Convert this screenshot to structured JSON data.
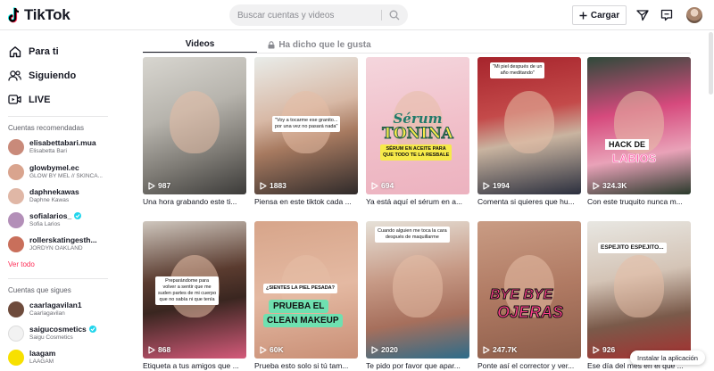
{
  "header": {
    "logo_text": "TikTok",
    "search_placeholder": "Buscar cuentas y videos",
    "upload_label": "Cargar"
  },
  "sidebar": {
    "nav": [
      {
        "label": "Para ti",
        "icon": "home-icon"
      },
      {
        "label": "Siguiendo",
        "icon": "people-icon"
      },
      {
        "label": "LIVE",
        "icon": "live-icon"
      }
    ],
    "recommended_heading": "Cuentas recomendadas",
    "recommended": [
      {
        "name": "elisabettabari.mua",
        "sub": "Elisabetta Bari",
        "verified": false,
        "color": "#c98a7a"
      },
      {
        "name": "glowbymel.ec",
        "sub": "GLOW BY MEL // SKINCA...",
        "verified": false,
        "color": "#d9a48e"
      },
      {
        "name": "daphnekawas",
        "sub": "Daphne Kawas",
        "verified": false,
        "color": "#e0b7a6"
      },
      {
        "name": "sofialarios_",
        "sub": "Sofia Larios",
        "verified": true,
        "color": "#b38fb8"
      },
      {
        "name": "rollerskatingesth...",
        "sub": "JORDYN OAKLAND",
        "verified": false,
        "color": "#c96f5b"
      }
    ],
    "see_all": "Ver todo",
    "following_heading": "Cuentas que sigues",
    "following": [
      {
        "name": "caarlagavilan1",
        "sub": "Caarlagavilan",
        "verified": false,
        "color": "#6e4b3c"
      },
      {
        "name": "saigucosmetics",
        "sub": "Saigu Cosmetics",
        "verified": true,
        "color": "#f2f2f2"
      },
      {
        "name": "laagam",
        "sub": "LAAGAM",
        "verified": false,
        "color": "#f7e000"
      }
    ]
  },
  "tabs": {
    "videos": "Videos",
    "liked": "Ha dicho que le gusta"
  },
  "videos": [
    {
      "views": "987",
      "caption": "Una hora grabando este ti...",
      "bg": "linear-gradient(160deg,#d8d6d0 0%,#b7b4ad 40%,#7d7a74 70%,#3c3b39 100%)"
    },
    {
      "views": "1883",
      "caption": "Piensa en este tiktok cada ...",
      "bg": "linear-gradient(165deg,#e9ece9 0%,#d8b9a6 40%,#a77a60 60%,#2f2a2a 100%)",
      "overlay": "\"Voy a tocarme ese granito...\npor una vez no pasará nada\""
    },
    {
      "views": "694",
      "caption": "Ya está aquí el sérum en a...",
      "bg": "linear-gradient(170deg,#f4d6dd 0%,#f1c0ca 50%,#ecb2bf 100%)",
      "title1": "Sérum",
      "title2": "TONINA",
      "overlay": "SÉRUM EN ACEITE PARA\nQUE TODO TE LA RESBALE"
    },
    {
      "views": "1994",
      "caption": "Comenta si quieres que hu...",
      "bg": "linear-gradient(170deg,#a6242c 0%,#c44a4a 40%,#c9b4a0 60%,#2b2f3e 100%)",
      "overlay": "\"Mi piel después de un\naño meditando\""
    },
    {
      "views": "324.3K",
      "caption": "Con este truquito nunca m...",
      "bg": "linear-gradient(170deg,#2f4a3a 0%,#d64a7d 40%,#e9a2b8 70%,#2a3a2c 100%)",
      "title1": "HACK DE",
      "title2": "LABIOS"
    },
    {
      "views": "868",
      "caption": "Etiqueta a tus amigos que ...",
      "bg": "linear-gradient(170deg,#cfc7be 0%,#5a3b2f 40%,#3a2620 60%,#d45a7a 100%)",
      "overlay": "Preparándome para\nvolver a sentir que me\nsuden partes de mi cuerpo\nque no sabía ni que tenía"
    },
    {
      "views": "60K",
      "caption": "Prueba esto solo si tú tam...",
      "bg": "linear-gradient(170deg,#d7a58a 0%,#e4b9a2 50%,#c98f76 100%)",
      "overlay": "¿SIENTES LA PIEL PESADA?",
      "title1": "PRUEBA EL",
      "title2": "CLEAN MAKEUP"
    },
    {
      "views": "2020",
      "caption": "Te pido por favor que apar...",
      "bg": "linear-gradient(170deg,#e6e1d8 0%,#c79a86 40%,#a66f5c 70%,#2d6c8a 100%)",
      "overlay": "Cuando alguien me toca la cara\ndespués de maquillarme"
    },
    {
      "views": "247.7K",
      "caption": "Ponte así el corrector y ver...",
      "bg": "linear-gradient(170deg,#c99c84 0%,#b07a63 50%,#8d5e4b 100%)",
      "title1": "BYE BYE",
      "title2": "OJERAS"
    },
    {
      "views": "926",
      "caption": "Ese día del mes en el que ...",
      "bg": "linear-gradient(170deg,#e8e7e2 0%,#d4c4b6 40%,#7a5a4a 70%,#a63030 100%)",
      "overlay": "ESPEJITO ESPEJITO..."
    }
  ],
  "install_label": "Instalar la aplicación",
  "colors": {
    "accent": "#fe2c55",
    "verified": "#20d5ec"
  }
}
